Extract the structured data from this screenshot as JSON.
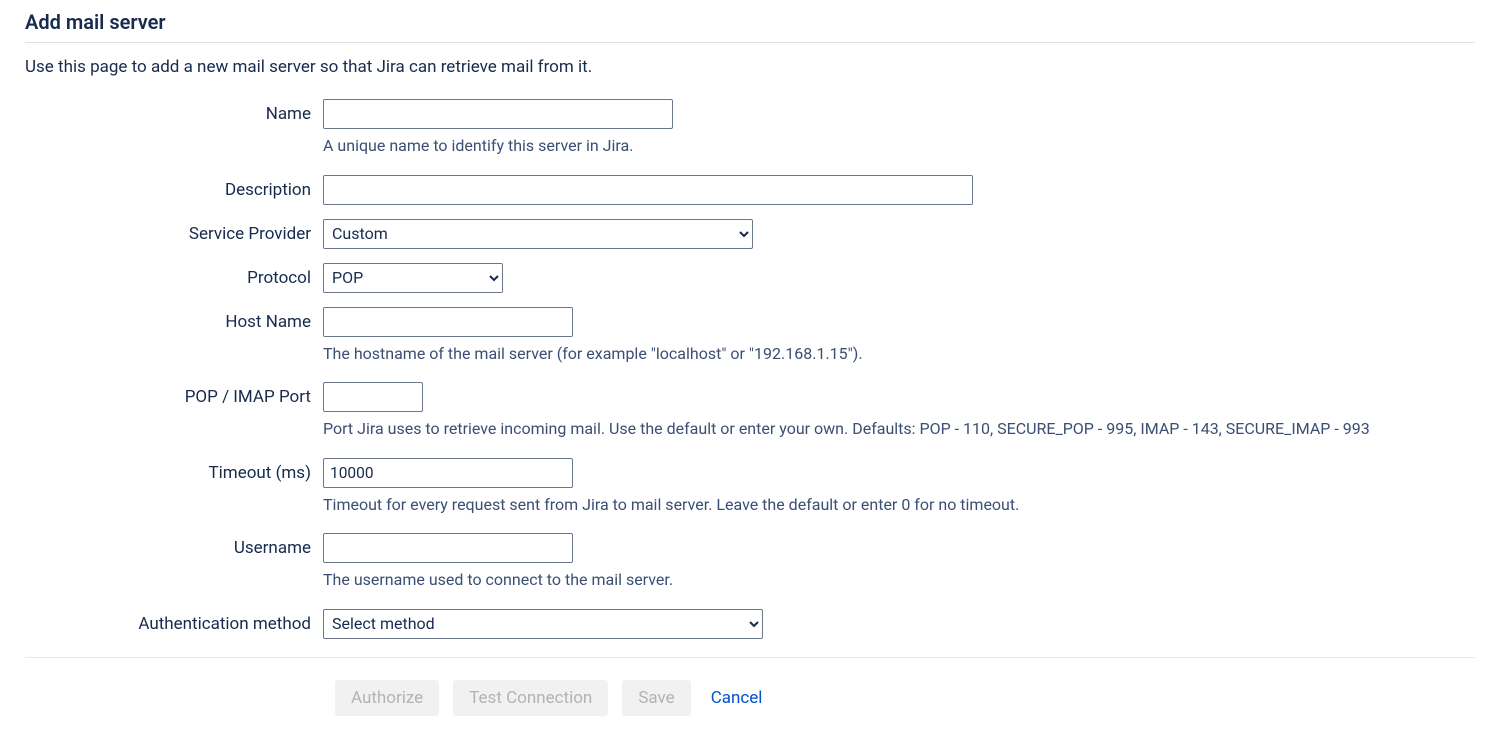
{
  "page": {
    "title": "Add mail server",
    "intro": "Use this page to add a new mail server so that Jira can retrieve mail from it."
  },
  "fields": {
    "name": {
      "label": "Name",
      "value": "",
      "help": "A unique name to identify this server in Jira."
    },
    "description": {
      "label": "Description",
      "value": ""
    },
    "service_provider": {
      "label": "Service Provider",
      "value": "Custom"
    },
    "protocol": {
      "label": "Protocol",
      "value": "POP"
    },
    "host_name": {
      "label": "Host Name",
      "value": "",
      "help": "The hostname of the mail server (for example \"localhost\" or \"192.168.1.15\")."
    },
    "port": {
      "label": "POP / IMAP Port",
      "value": "",
      "help": "Port Jira uses to retrieve incoming mail. Use the default or enter your own. Defaults: POP - 110, SECURE_POP - 995, IMAP - 143, SECURE_IMAP - 993"
    },
    "timeout": {
      "label": "Timeout (ms)",
      "value": "10000",
      "help": "Timeout for every request sent from Jira to mail server. Leave the default or enter 0 for no timeout."
    },
    "username": {
      "label": "Username",
      "value": "",
      "help": "The username used to connect to the mail server."
    },
    "auth_method": {
      "label": "Authentication method",
      "value": "Select method"
    }
  },
  "buttons": {
    "authorize": "Authorize",
    "test_connection": "Test Connection",
    "save": "Save",
    "cancel": "Cancel"
  }
}
